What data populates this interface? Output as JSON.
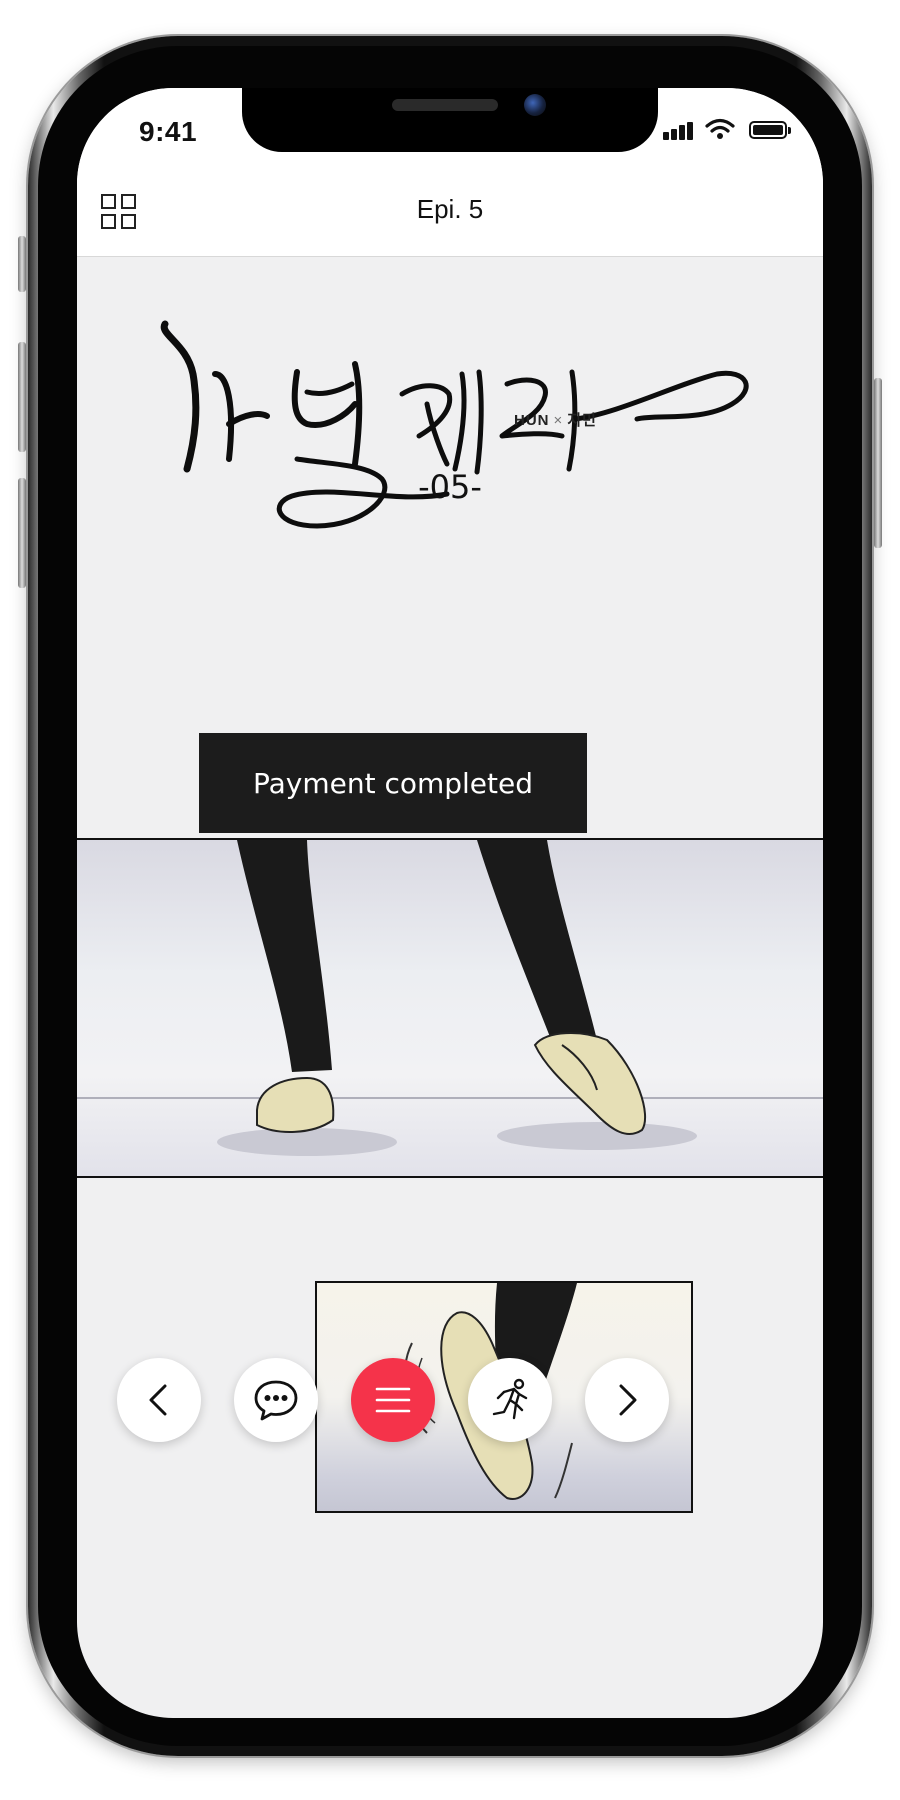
{
  "status_bar": {
    "time": "9:41"
  },
  "header": {
    "title": "Epi. 5",
    "menu_icon": "grid-icon"
  },
  "cover": {
    "logo_icon": "handwritten-title-logo",
    "credit_author": "HUN",
    "credit_sep": "×",
    "credit_artist": "지민",
    "episode_number": "-05-"
  },
  "toast": {
    "message": "Payment completed"
  },
  "bottom_nav": {
    "prev_icon": "chevron-left-icon",
    "comments_icon": "chat-bubble-icon",
    "menu_icon": "hamburger-icon",
    "auto_scroll_icon": "running-person-icon",
    "next_icon": "chevron-right-icon",
    "accent_color": "#f5334a"
  }
}
